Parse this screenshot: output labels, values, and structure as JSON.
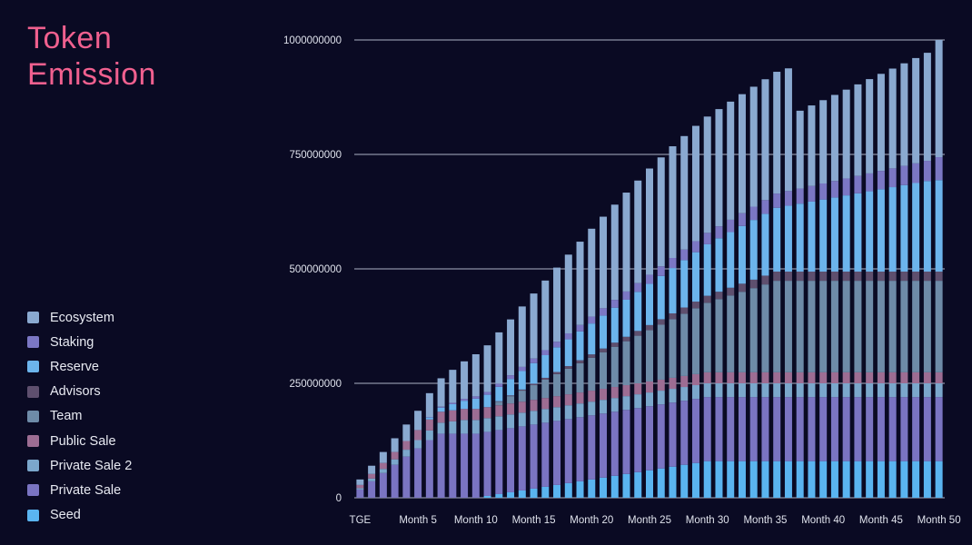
{
  "title": {
    "line1": "Token",
    "line2": "Emission",
    "color": "#f0608f"
  },
  "background_color": "#0a0a23",
  "legend": {
    "items": [
      {
        "label": "Ecosystem",
        "color": "#8aa9d0"
      },
      {
        "label": "Staking",
        "color": "#7b77c4"
      },
      {
        "label": "Reserve",
        "color": "#6cb4ec"
      },
      {
        "label": "Advisors",
        "color": "#5e4f6e"
      },
      {
        "label": "Team",
        "color": "#6e8ba8"
      },
      {
        "label": "Public Sale",
        "color": "#9d6d93"
      },
      {
        "label": "Private Sale 2",
        "color": "#7ba7cc"
      },
      {
        "label": "Private Sale",
        "color": "#7a74c2"
      },
      {
        "label": "Seed",
        "color": "#5ab4f0"
      }
    ]
  },
  "chart_data": {
    "type": "bar",
    "stacked": true,
    "title": "Token Emission",
    "xlabel": "",
    "ylabel": "",
    "ylim": [
      0,
      1000000000
    ],
    "yticks": [
      0,
      250000000,
      500000000,
      750000000,
      1000000000
    ],
    "ytick_labels": [
      "0",
      "250000000",
      "500000000",
      "750000000",
      "1000000000"
    ],
    "grid": true,
    "grid_color": "#9aa0b4",
    "legend_position": "left",
    "x": [
      "TGE",
      "Month 1",
      "Month 2",
      "Month 3",
      "Month 4",
      "Month 5",
      "Month 6",
      "Month 7",
      "Month 8",
      "Month 9",
      "Month 10",
      "Month 11",
      "Month 12",
      "Month 13",
      "Month 14",
      "Month 15",
      "Month 16",
      "Month 17",
      "Month 18",
      "Month 19",
      "Month 20",
      "Month 21",
      "Month 22",
      "Month 23",
      "Month 24",
      "Month 25",
      "Month 26",
      "Month 27",
      "Month 28",
      "Month 29",
      "Month 30",
      "Month 31",
      "Month 32",
      "Month 33",
      "Month 34",
      "Month 35",
      "Month 36",
      "Month 37",
      "Month 38",
      "Month 39",
      "Month 40",
      "Month 41",
      "Month 42",
      "Month 43",
      "Month 44",
      "Month 45",
      "Month 46",
      "Month 47",
      "Month 48",
      "Month 49",
      "Month 50"
    ],
    "xtick_labels": [
      "TGE",
      "Month 5",
      "Month 10",
      "Month 15",
      "Month 20",
      "Month 25",
      "Month 30",
      "Month 35",
      "Month 40",
      "Month 45",
      "Month 50"
    ],
    "xtick_indices": [
      0,
      5,
      10,
      15,
      20,
      25,
      30,
      35,
      40,
      45,
      50
    ],
    "series": [
      {
        "name": "Seed",
        "color": "#5ab4f0",
        "values": [
          0,
          0,
          0,
          0,
          0,
          0,
          0,
          0,
          0,
          0,
          0,
          4000000,
          8000000,
          12000000,
          16000000,
          20000000,
          24000000,
          28000000,
          32000000,
          36000000,
          40000000,
          44000000,
          48000000,
          52000000,
          56000000,
          60000000,
          64000000,
          68000000,
          72000000,
          76000000,
          80000000,
          80000000,
          80000000,
          80000000,
          80000000,
          80000000,
          80000000,
          80000000,
          80000000,
          80000000,
          80000000,
          80000000,
          80000000,
          80000000,
          80000000,
          80000000,
          80000000,
          80000000,
          80000000,
          80000000,
          80000000
        ]
      },
      {
        "name": "Private Sale",
        "color": "#7a74c2",
        "values": [
          18000000,
          36000000,
          54000000,
          72000000,
          90000000,
          108000000,
          126000000,
          140000000,
          140000000,
          140000000,
          140000000,
          140000000,
          140000000,
          140000000,
          140000000,
          140000000,
          140000000,
          140000000,
          140000000,
          140000000,
          140000000,
          140000000,
          140000000,
          140000000,
          140000000,
          140000000,
          140000000,
          140000000,
          140000000,
          140000000,
          140000000,
          140000000,
          140000000,
          140000000,
          140000000,
          140000000,
          140000000,
          140000000,
          140000000,
          140000000,
          140000000,
          140000000,
          140000000,
          140000000,
          140000000,
          140000000,
          140000000,
          140000000,
          140000000,
          140000000,
          140000000
        ]
      },
      {
        "name": "Private Sale 2",
        "color": "#7ba7cc",
        "values": [
          3000000,
          6000000,
          9000000,
          12000000,
          15000000,
          18000000,
          21000000,
          24000000,
          27000000,
          30000000,
          30000000,
          30000000,
          30000000,
          30000000,
          30000000,
          30000000,
          30000000,
          30000000,
          30000000,
          30000000,
          30000000,
          30000000,
          30000000,
          30000000,
          30000000,
          30000000,
          30000000,
          30000000,
          30000000,
          30000000,
          30000000,
          30000000,
          30000000,
          30000000,
          30000000,
          30000000,
          30000000,
          30000000,
          30000000,
          30000000,
          30000000,
          30000000,
          30000000,
          30000000,
          30000000,
          30000000,
          30000000,
          30000000,
          30000000,
          30000000,
          30000000
        ]
      },
      {
        "name": "Public Sale",
        "color": "#9d6d93",
        "values": [
          7000000,
          10000000,
          13000000,
          16000000,
          19000000,
          22000000,
          24000000,
          24000000,
          24000000,
          24000000,
          24000000,
          24000000,
          24000000,
          24000000,
          24000000,
          24000000,
          24000000,
          24000000,
          24000000,
          24000000,
          24000000,
          24000000,
          24000000,
          24000000,
          24000000,
          24000000,
          24000000,
          24000000,
          24000000,
          24000000,
          24000000,
          24000000,
          24000000,
          24000000,
          24000000,
          24000000,
          24000000,
          24000000,
          24000000,
          24000000,
          24000000,
          24000000,
          24000000,
          24000000,
          24000000,
          24000000,
          24000000,
          24000000,
          24000000,
          24000000,
          24000000
        ]
      },
      {
        "name": "Team",
        "color": "#6e8ba8",
        "values": [
          0,
          0,
          0,
          0,
          0,
          0,
          0,
          0,
          0,
          0,
          0,
          0,
          8000000,
          16000000,
          24000000,
          32000000,
          40000000,
          48000000,
          56000000,
          64000000,
          72000000,
          80000000,
          88000000,
          96000000,
          104000000,
          112000000,
          120000000,
          128000000,
          136000000,
          144000000,
          152000000,
          160000000,
          168000000,
          176000000,
          184000000,
          192000000,
          200000000,
          200000000,
          200000000,
          200000000,
          200000000,
          200000000,
          200000000,
          200000000,
          200000000,
          200000000,
          200000000,
          200000000,
          200000000,
          200000000,
          200000000
        ]
      },
      {
        "name": "Advisors",
        "color": "#5e4f6e",
        "values": [
          0,
          0,
          0,
          0,
          0,
          0,
          0,
          0,
          0,
          0,
          0,
          0,
          800000,
          1600000,
          2400000,
          3200000,
          4000000,
          4800000,
          5600000,
          6400000,
          7200000,
          8000000,
          8800000,
          9600000,
          10400000,
          11200000,
          12000000,
          12800000,
          13600000,
          14400000,
          15200000,
          16000000,
          16800000,
          17600000,
          18400000,
          19200000,
          20000000,
          20000000,
          20000000,
          20000000,
          20000000,
          20000000,
          20000000,
          20000000,
          20000000,
          20000000,
          20000000,
          20000000,
          20000000,
          20000000,
          20000000
        ]
      },
      {
        "name": "Reserve",
        "color": "#6cb4ec",
        "values": [
          0,
          0,
          0,
          0,
          0,
          0,
          4500000,
          9000000,
          13500000,
          18000000,
          22500000,
          27000000,
          31500000,
          36000000,
          40500000,
          45000000,
          49500000,
          54000000,
          58500000,
          63000000,
          67500000,
          72000000,
          76500000,
          81000000,
          85500000,
          90000000,
          94500000,
          99000000,
          103500000,
          108000000,
          112500000,
          117000000,
          121500000,
          126000000,
          130500000,
          135000000,
          139500000,
          144000000,
          148500000,
          153000000,
          157500000,
          162000000,
          166500000,
          171000000,
          175500000,
          180000000,
          184500000,
          189000000,
          193500000,
          198000000,
          200000000
        ]
      },
      {
        "name": "Staking",
        "color": "#7b77c4",
        "values": [
          0,
          0,
          0,
          0,
          0,
          0,
          1000000,
          2000000,
          3000000,
          4000000,
          5000000,
          6000000,
          7000000,
          8000000,
          9000000,
          10000000,
          11000000,
          12000000,
          13000000,
          14000000,
          15000000,
          16000000,
          17000000,
          18000000,
          19000000,
          20000000,
          21000000,
          22000000,
          23000000,
          24000000,
          25000000,
          26000000,
          27000000,
          28000000,
          29000000,
          30000000,
          31000000,
          32000000,
          33000000,
          34000000,
          35000000,
          36000000,
          37000000,
          38000000,
          39000000,
          40000000,
          41000000,
          42000000,
          43000000,
          44000000,
          50000000
        ]
      },
      {
        "name": "Ecosystem",
        "color": "#8aa9d0",
        "values": [
          12000000,
          18000000,
          24000000,
          30000000,
          36000000,
          42000000,
          52000000,
          62000000,
          72000000,
          82000000,
          92000000,
          102000000,
          112000000,
          122000000,
          132000000,
          142000000,
          152000000,
          162000000,
          172000000,
          182000000,
          192000000,
          200000000,
          208000000,
          216000000,
          224000000,
          232000000,
          238000000,
          244000000,
          248000000,
          252000000,
          254000000,
          256000000,
          258000000,
          260000000,
          262000000,
          264000000,
          266000000,
          268000000,
          170000000,
          176000000,
          182000000,
          188000000,
          194000000,
          200000000,
          206000000,
          212000000,
          218000000,
          224000000,
          230000000,
          236000000,
          256000000
        ]
      }
    ]
  }
}
